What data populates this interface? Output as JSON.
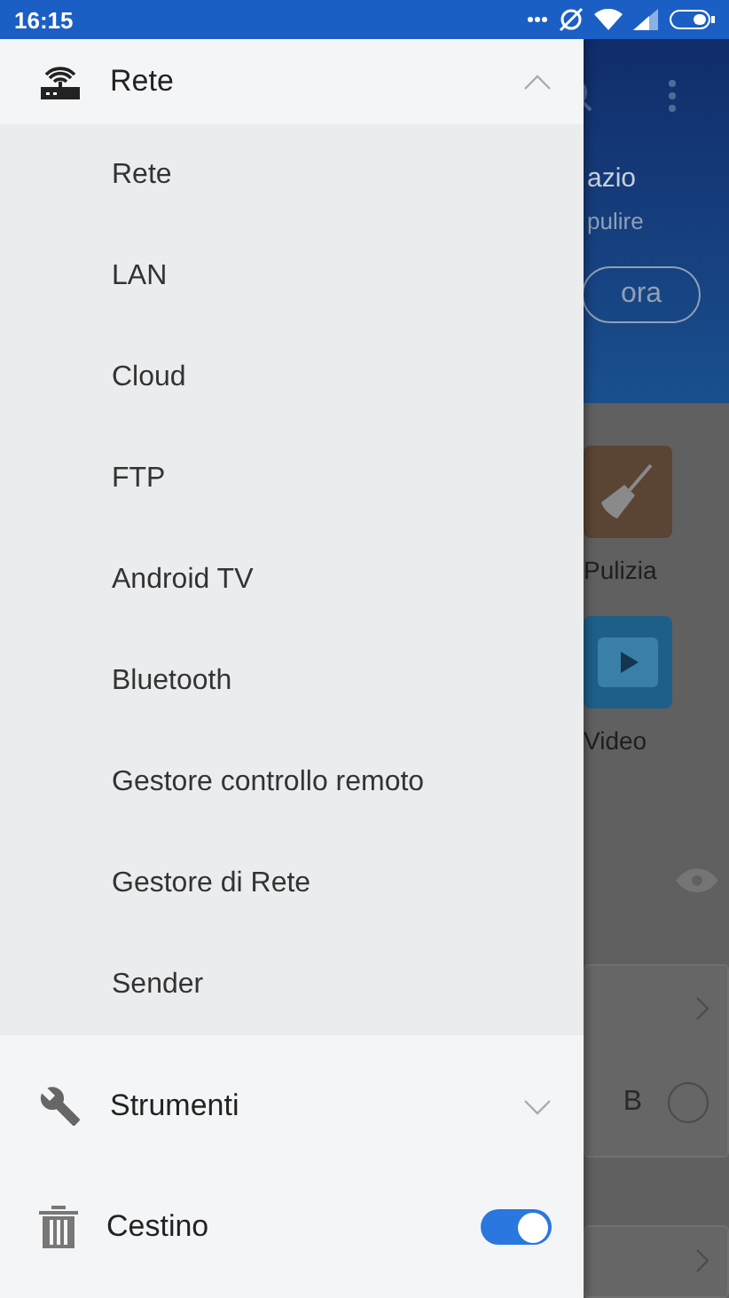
{
  "status_bar": {
    "time": "16:15"
  },
  "drawer": {
    "items": [
      {
        "kind": "group",
        "label": "Rete",
        "expanded": true,
        "children": [
          {
            "label": "Rete"
          },
          {
            "label": "LAN"
          },
          {
            "label": "Cloud"
          },
          {
            "label": "FTP"
          },
          {
            "label": "Android TV"
          },
          {
            "label": "Bluetooth"
          },
          {
            "label": "Gestore controllo remoto"
          },
          {
            "label": "Gestore di Rete"
          },
          {
            "label": "Sender"
          }
        ]
      },
      {
        "kind": "group",
        "label": "Strumenti",
        "expanded": false
      },
      {
        "kind": "toggle",
        "label": "Cestino",
        "on": true
      }
    ]
  },
  "background_app": {
    "header_lines": [
      "azio",
      "pulire"
    ],
    "button": "ora",
    "tiles": [
      {
        "label": "Pulizia"
      },
      {
        "label": "Video"
      }
    ],
    "card_text": "B"
  }
}
